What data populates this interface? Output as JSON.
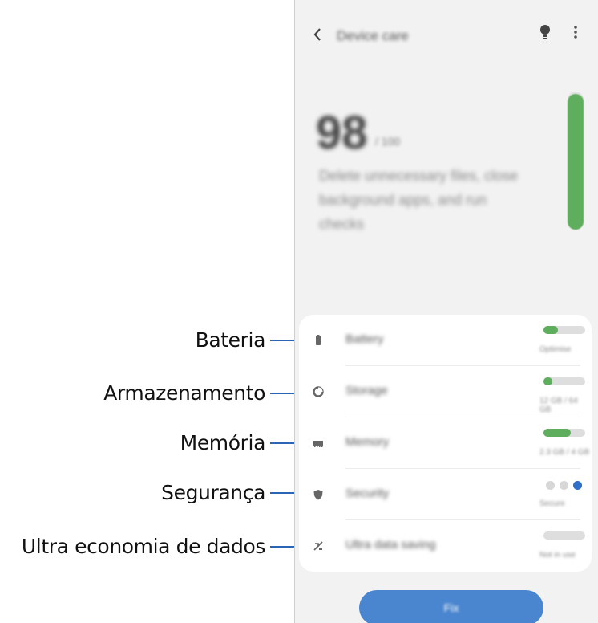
{
  "app": {
    "title": "Device care",
    "back_icon": "chevron-left-icon",
    "tips_icon": "lightbulb-icon",
    "more_icon": "more-vert-icon"
  },
  "score": {
    "value": "98",
    "max": "/ 100",
    "description": "Delete unnecessary files, close background apps, and run checks",
    "level_fraction": 0.98
  },
  "items": [
    {
      "name": "Battery",
      "status": "Optimise",
      "icon": "battery-icon",
      "level": 0.35
    },
    {
      "name": "Storage",
      "status": "12 GB / 64 GB",
      "icon": "storage-icon",
      "level": 0.22
    },
    {
      "name": "Memory",
      "status": "2.3 GB / 4 GB",
      "icon": "memory-icon",
      "level": 0.65
    },
    {
      "name": "Security",
      "status": "Secure",
      "icon": "shield-icon"
    },
    {
      "name": "Ultra data saving",
      "status": "Not in use",
      "icon": "data-saving-icon"
    }
  ],
  "button": {
    "label": "Fix"
  },
  "callouts": [
    "Bateria",
    "Armazenamento",
    "Memória",
    "Segurança",
    "Ultra economia de dados"
  ],
  "colors": {
    "accent": "#4a86cf",
    "green": "#5fae5d",
    "callout_line": "#2a64b4"
  }
}
